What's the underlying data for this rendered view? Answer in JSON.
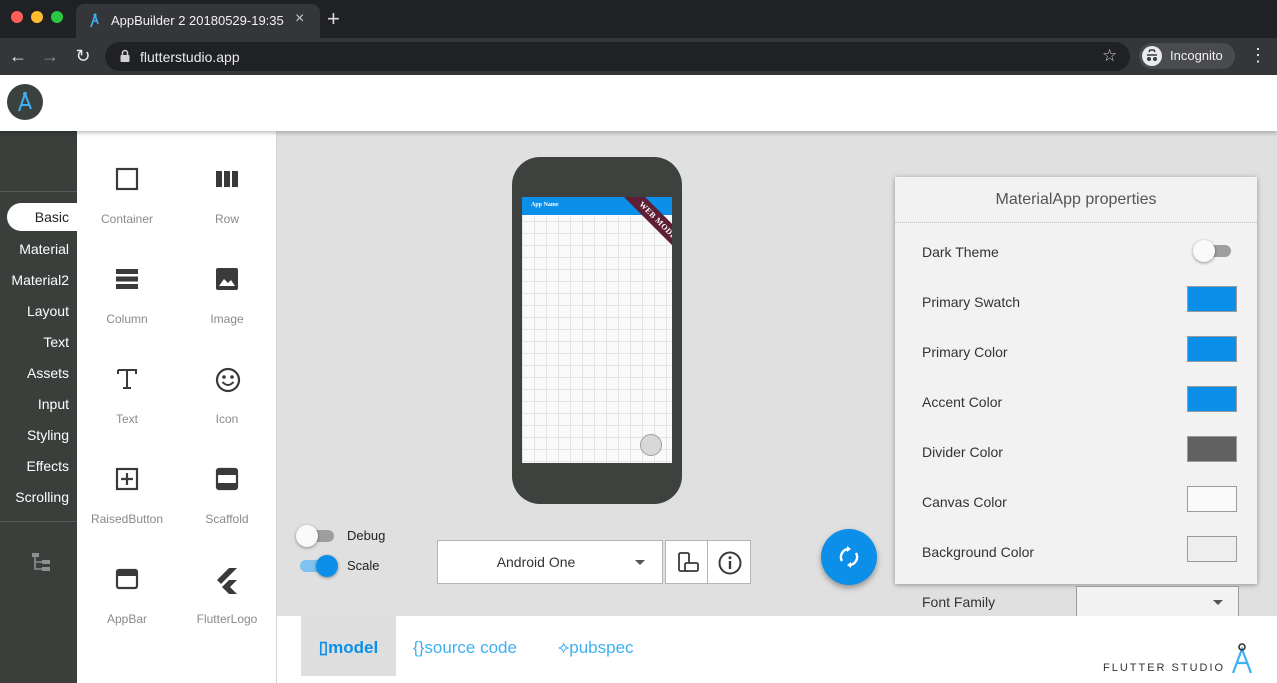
{
  "browser": {
    "tab_title": "AppBuilder 2 20180529-19:35",
    "tab_close": "×",
    "new_tab": "+",
    "url": "flutterstudio.app",
    "incognito_label": "Incognito",
    "back": "←",
    "forward": "→",
    "reload": "↻",
    "star": "☆",
    "menu": "⋮"
  },
  "sidebar": {
    "categories": [
      "Basic",
      "Material",
      "Material2",
      "Layout",
      "Text",
      "Assets",
      "Input",
      "Styling",
      "Effects",
      "Scrolling"
    ],
    "active": "Basic"
  },
  "palette": {
    "widgets": [
      {
        "label": "Container",
        "icon": "container-icon"
      },
      {
        "label": "Row",
        "icon": "row-icon"
      },
      {
        "label": "Column",
        "icon": "column-icon"
      },
      {
        "label": "Image",
        "icon": "image-icon"
      },
      {
        "label": "Text",
        "icon": "text-icon"
      },
      {
        "label": "Icon",
        "icon": "smiley-icon"
      },
      {
        "label": "RaisedButton",
        "icon": "add-box-icon"
      },
      {
        "label": "Scaffold",
        "icon": "scaffold-icon"
      },
      {
        "label": "AppBar",
        "icon": "appbar-icon"
      },
      {
        "label": "FlutterLogo",
        "icon": "flutter-logo-icon"
      }
    ]
  },
  "preview": {
    "app_title": "App Name",
    "ribbon": "WEB MODE",
    "appbar_color": "#0b8fe8",
    "ribbon_color": "#5e1f36"
  },
  "controls": {
    "debug_label": "Debug",
    "debug_on": false,
    "scale_label": "Scale",
    "scale_on": true,
    "device": "Android One"
  },
  "properties": {
    "title": "MaterialApp properties",
    "dark_theme_label": "Dark Theme",
    "dark_theme_on": false,
    "rows": [
      {
        "label": "Primary Swatch",
        "color": "#0b8fe8"
      },
      {
        "label": "Primary Color",
        "color": "#0b8fe8"
      },
      {
        "label": "Accent Color",
        "color": "#0b8fe8"
      },
      {
        "label": "Divider Color",
        "color": "#616161"
      },
      {
        "label": "Canvas Color",
        "color": "#fafafa"
      },
      {
        "label": "Background Color",
        "color": "#eeeeee"
      }
    ],
    "font_family_label": "Font Family",
    "font_family_value": ""
  },
  "bottom": {
    "tabs": [
      {
        "label": "model",
        "glyph": "▯"
      },
      {
        "label": "source code",
        "glyph": "{}"
      },
      {
        "label": "pubspec",
        "glyph": "⟡"
      }
    ],
    "active": "model",
    "brand": "FLUTTER STUDIO"
  },
  "colors": {
    "accent": "#0b8fe8",
    "sidebar_bg": "#3a3f3c"
  }
}
